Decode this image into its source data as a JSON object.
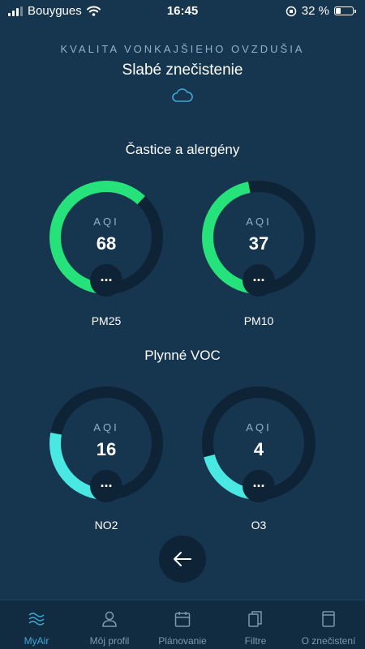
{
  "status_bar": {
    "carrier": "Bouygues",
    "time": "16:45",
    "battery": "32 %",
    "battery_level": 0.32
  },
  "header": {
    "title": "KVALITA VONKAJŠIEHO OVZDUŠIA",
    "status": "Slabé znečistenie",
    "icon": "cloud-icon"
  },
  "sections": [
    {
      "title": "Častice a alergény",
      "gauges": [
        {
          "label": "AQI",
          "value": "68",
          "name": "PM25",
          "fraction": 0.62,
          "color": "#26e27a",
          "more": "..."
        },
        {
          "label": "AQI",
          "value": "37",
          "name": "PM10",
          "fraction": 0.47,
          "color": "#26e27a",
          "more": "..."
        }
      ]
    },
    {
      "title": "Plynné VOC",
      "gauges": [
        {
          "label": "AQI",
          "value": "16",
          "name": "NO2",
          "fraction": 0.28,
          "color": "#49e8e3",
          "more": "..."
        },
        {
          "label": "AQI",
          "value": "4",
          "name": "O3",
          "fraction": 0.21,
          "color": "#49e8e3",
          "more": "..."
        }
      ]
    }
  ],
  "back_button": {
    "icon": "arrow-left-icon"
  },
  "tabbar": {
    "items": [
      {
        "label": "MyAir",
        "icon": "waves-icon",
        "active": true
      },
      {
        "label": "Môj profil",
        "icon": "user-icon",
        "active": false
      },
      {
        "label": "Plánovanie",
        "icon": "calendar-icon",
        "active": false
      },
      {
        "label": "Filtre",
        "icon": "filter-icon",
        "active": false
      },
      {
        "label": "O znečistení",
        "icon": "book-icon",
        "active": false
      }
    ]
  },
  "colors": {
    "background": "#16354f",
    "ring_track": "#0e2436",
    "particles_ring": "#26e27a",
    "gas_ring": "#49e8e3",
    "accent": "#3fa9d6"
  }
}
